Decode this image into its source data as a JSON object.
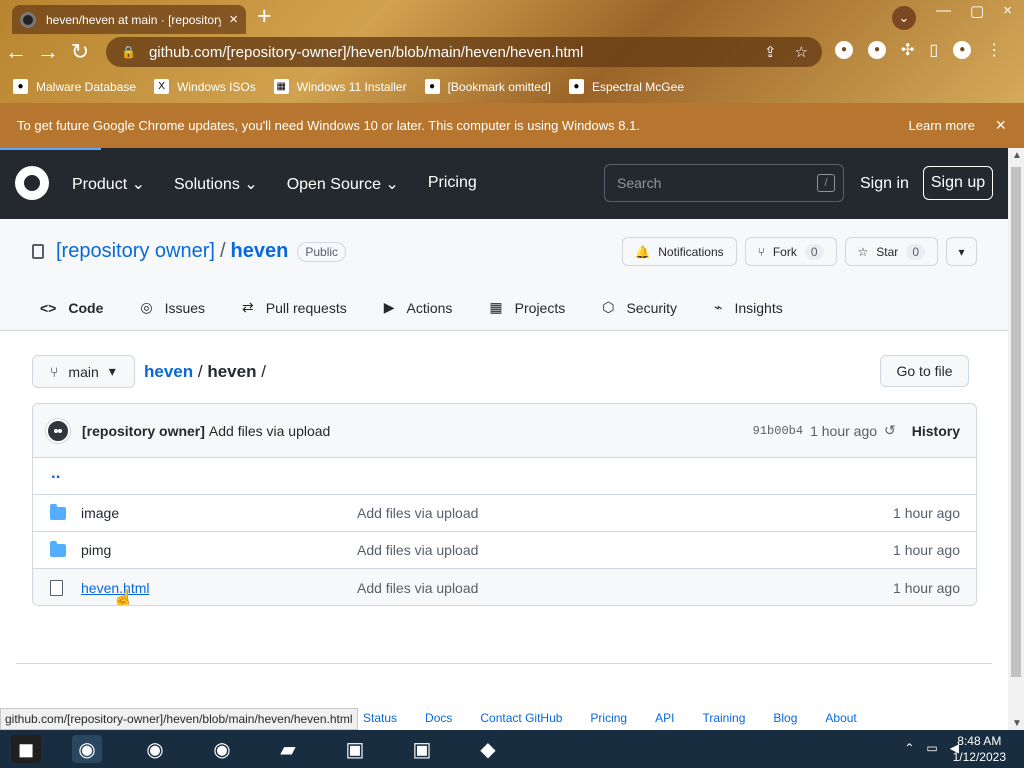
{
  "browser": {
    "tab_title": "heven/heven at main · [repository owner]",
    "url": "github.com/[repository-owner]/heven/blob/main/heven/heven.html",
    "bookmarks": [
      "Malware Database",
      "Windows ISOs",
      "Windows 11 Installer",
      "[Bookmark omitted]",
      "Espectral McGee"
    ],
    "notice": "To get future Google Chrome updates, you'll need Windows 10 or later. This computer is using Windows 8.1.",
    "learn_more": "Learn more"
  },
  "github": {
    "nav": [
      "Product",
      "Solutions",
      "Open Source",
      "Pricing"
    ],
    "search_placeholder": "Search",
    "search_key": "/",
    "sign_in": "Sign in",
    "sign_up": "Sign up"
  },
  "repo": {
    "owner": "[repository owner]",
    "name": "heven",
    "visibility": "Public",
    "notifications": "Notifications",
    "fork": "Fork",
    "fork_count": "0",
    "star": "Star",
    "star_count": "0",
    "tabs": [
      "Code",
      "Issues",
      "Pull requests",
      "Actions",
      "Projects",
      "Security",
      "Insights"
    ]
  },
  "browser_view": {
    "branch": "main",
    "breadcrumb_repo": "heven",
    "breadcrumb_folder": "heven",
    "breadcrumb_separator": "/",
    "go_to_file": "Go to file",
    "parent_link": ".."
  },
  "commit": {
    "author": "[repository owner]",
    "message": "Add files via upload",
    "hash": "91b00b4",
    "time": "1 hour ago",
    "history": "History"
  },
  "files": [
    {
      "name": "image",
      "message": "Add files via upload",
      "age": "1 hour ago"
    },
    {
      "name": "pimg",
      "message": "Add files via upload",
      "age": "1 hour ago"
    },
    {
      "name": "heven.html",
      "message": "Add files via upload",
      "age": "1 hour ago"
    }
  ],
  "status_url": "github.com/[repository-owner]/heven/blob/main/heven/heven.html",
  "footer_links": [
    "Status",
    "Docs",
    "Contact GitHub",
    "Pricing",
    "API",
    "Training",
    "Blog",
    "About"
  ],
  "taskbar": {
    "time": "8:48 AM",
    "date": "1/12/2023"
  }
}
